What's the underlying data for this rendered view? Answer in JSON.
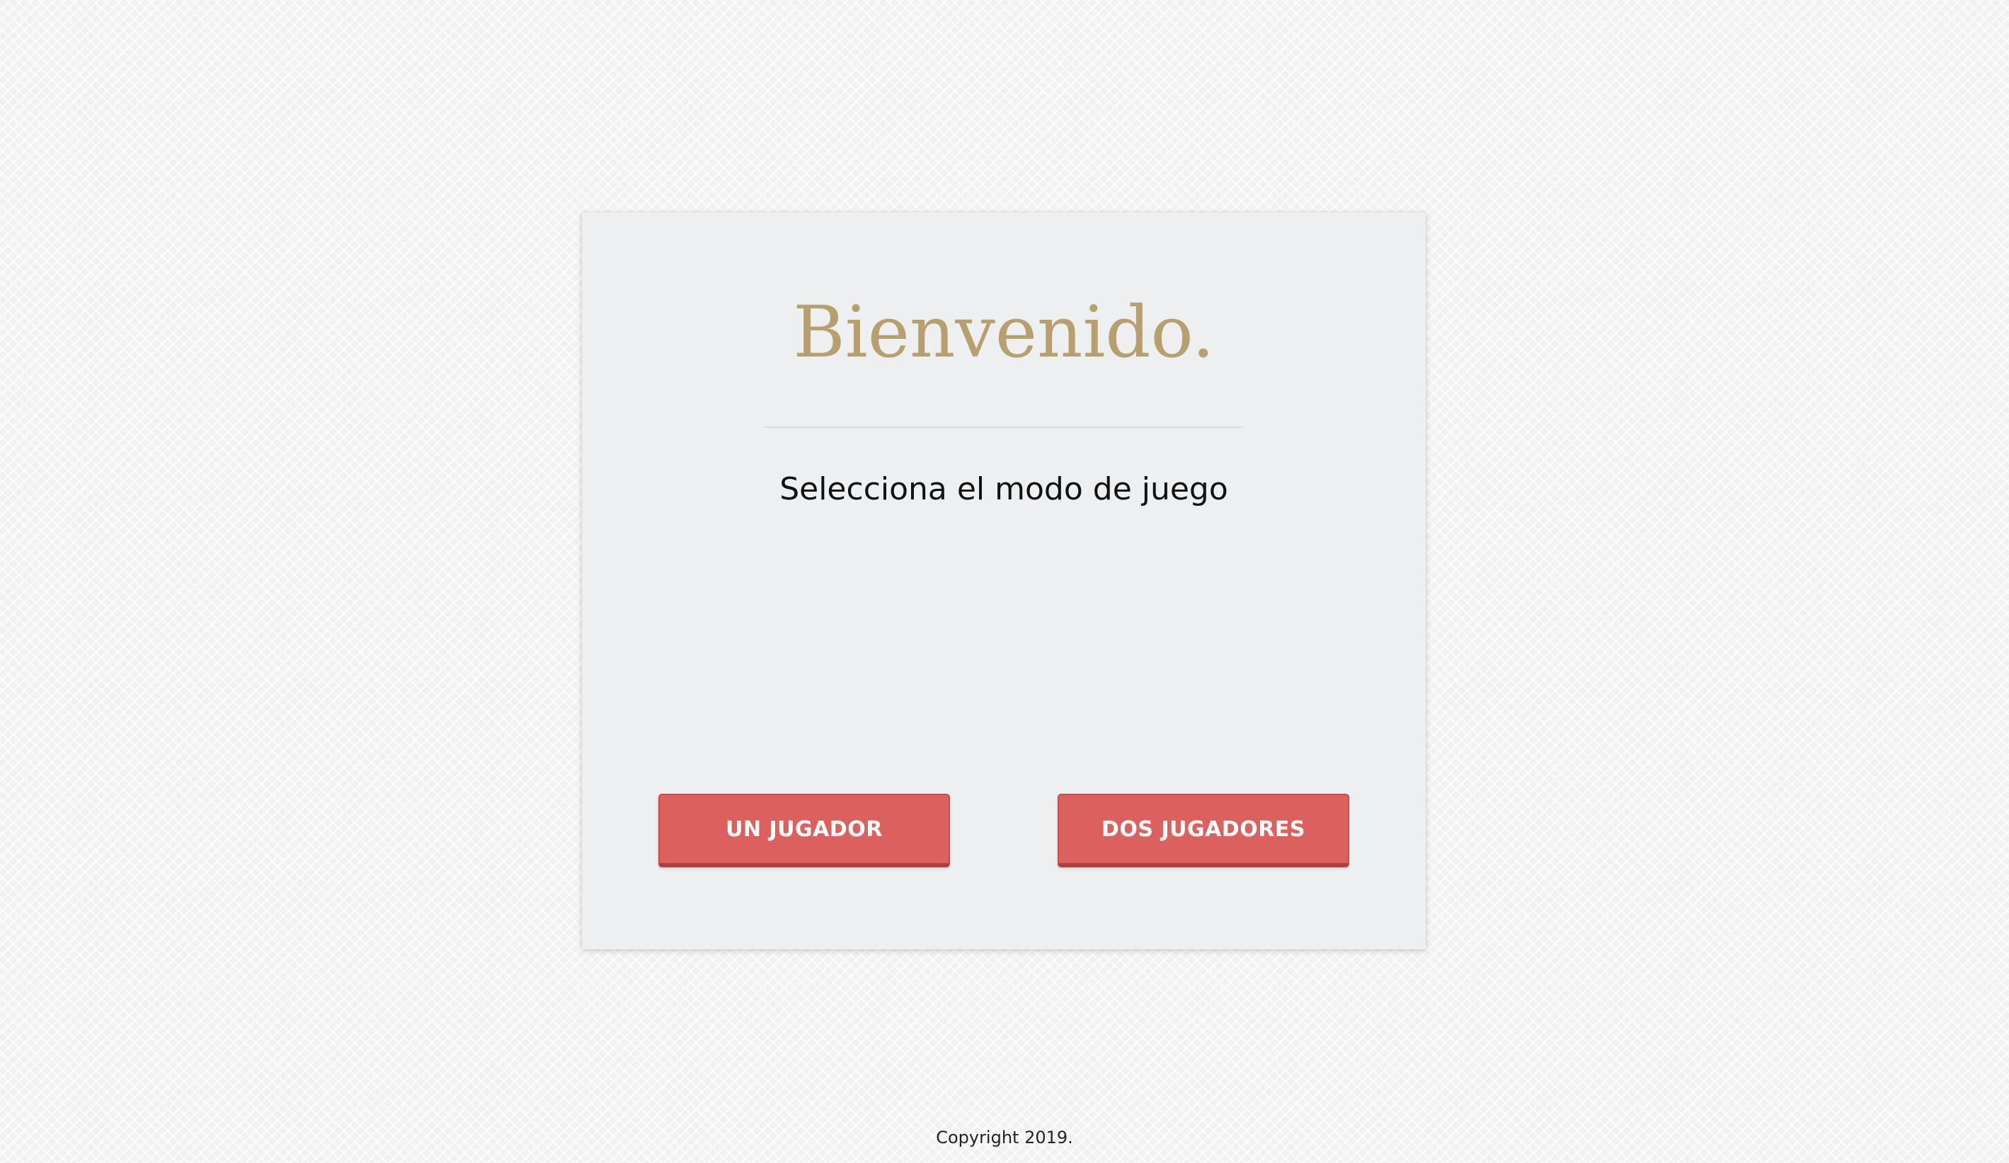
{
  "card": {
    "title": "Bienvenido.",
    "subtitle": "Selecciona el modo de juego",
    "buttons": {
      "one_player": "UN JUGADOR",
      "two_players": "DOS JUGADORES"
    }
  },
  "footer": {
    "copyright": "Copyright 2019."
  },
  "colors": {
    "title": "#b89f6e",
    "button": "#dc605d",
    "card": "#eeeff0"
  }
}
